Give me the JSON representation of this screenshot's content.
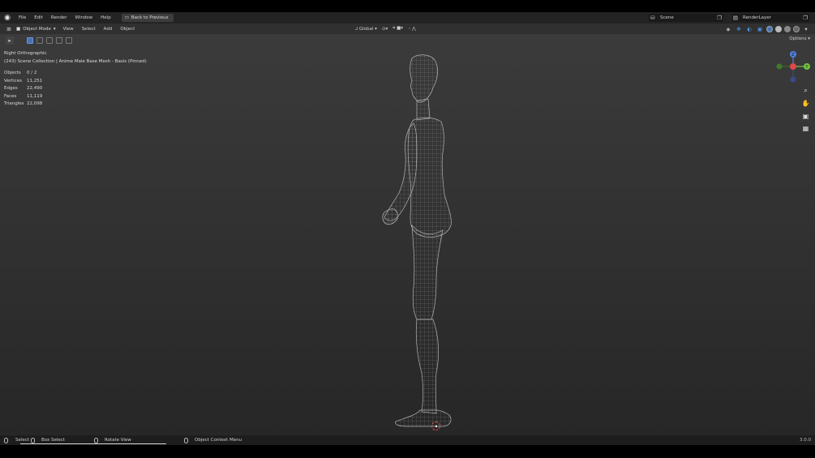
{
  "topbar": {
    "menus": [
      "File",
      "Edit",
      "Render",
      "Window",
      "Help"
    ],
    "back_label": "Back to Previous",
    "scene_label": "Scene",
    "render_layer_label": "RenderLayer"
  },
  "header": {
    "mode_label": "Object Mode",
    "menus": [
      "View",
      "Select",
      "Add",
      "Object"
    ],
    "transform_label": "Global",
    "options_label": "Options"
  },
  "viewport": {
    "view_name": "Right Orthographic",
    "collection_line": "(243) Scene Collection | Anime Male Base Mesh - Basis (Pinned)",
    "stats": [
      {
        "key": "Objects",
        "value": "0 / 2"
      },
      {
        "key": "Vertices",
        "value": "11,251"
      },
      {
        "key": "Edges",
        "value": "22,490"
      },
      {
        "key": "Faces",
        "value": "11,119"
      },
      {
        "key": "Triangles",
        "value": "22,098"
      }
    ],
    "gizmo_axes": {
      "z": "Z",
      "y": "Y"
    }
  },
  "statusbar": {
    "select": "Select",
    "box_select": "Box Select",
    "rotate_view": "Rotate View",
    "context_menu": "Object Context Menu",
    "version": "3.0.0"
  },
  "colors": {
    "x_axis": "#e04848",
    "y_axis": "#6ec23e",
    "z_axis": "#4f7fe0",
    "accent": "#4772b3"
  }
}
